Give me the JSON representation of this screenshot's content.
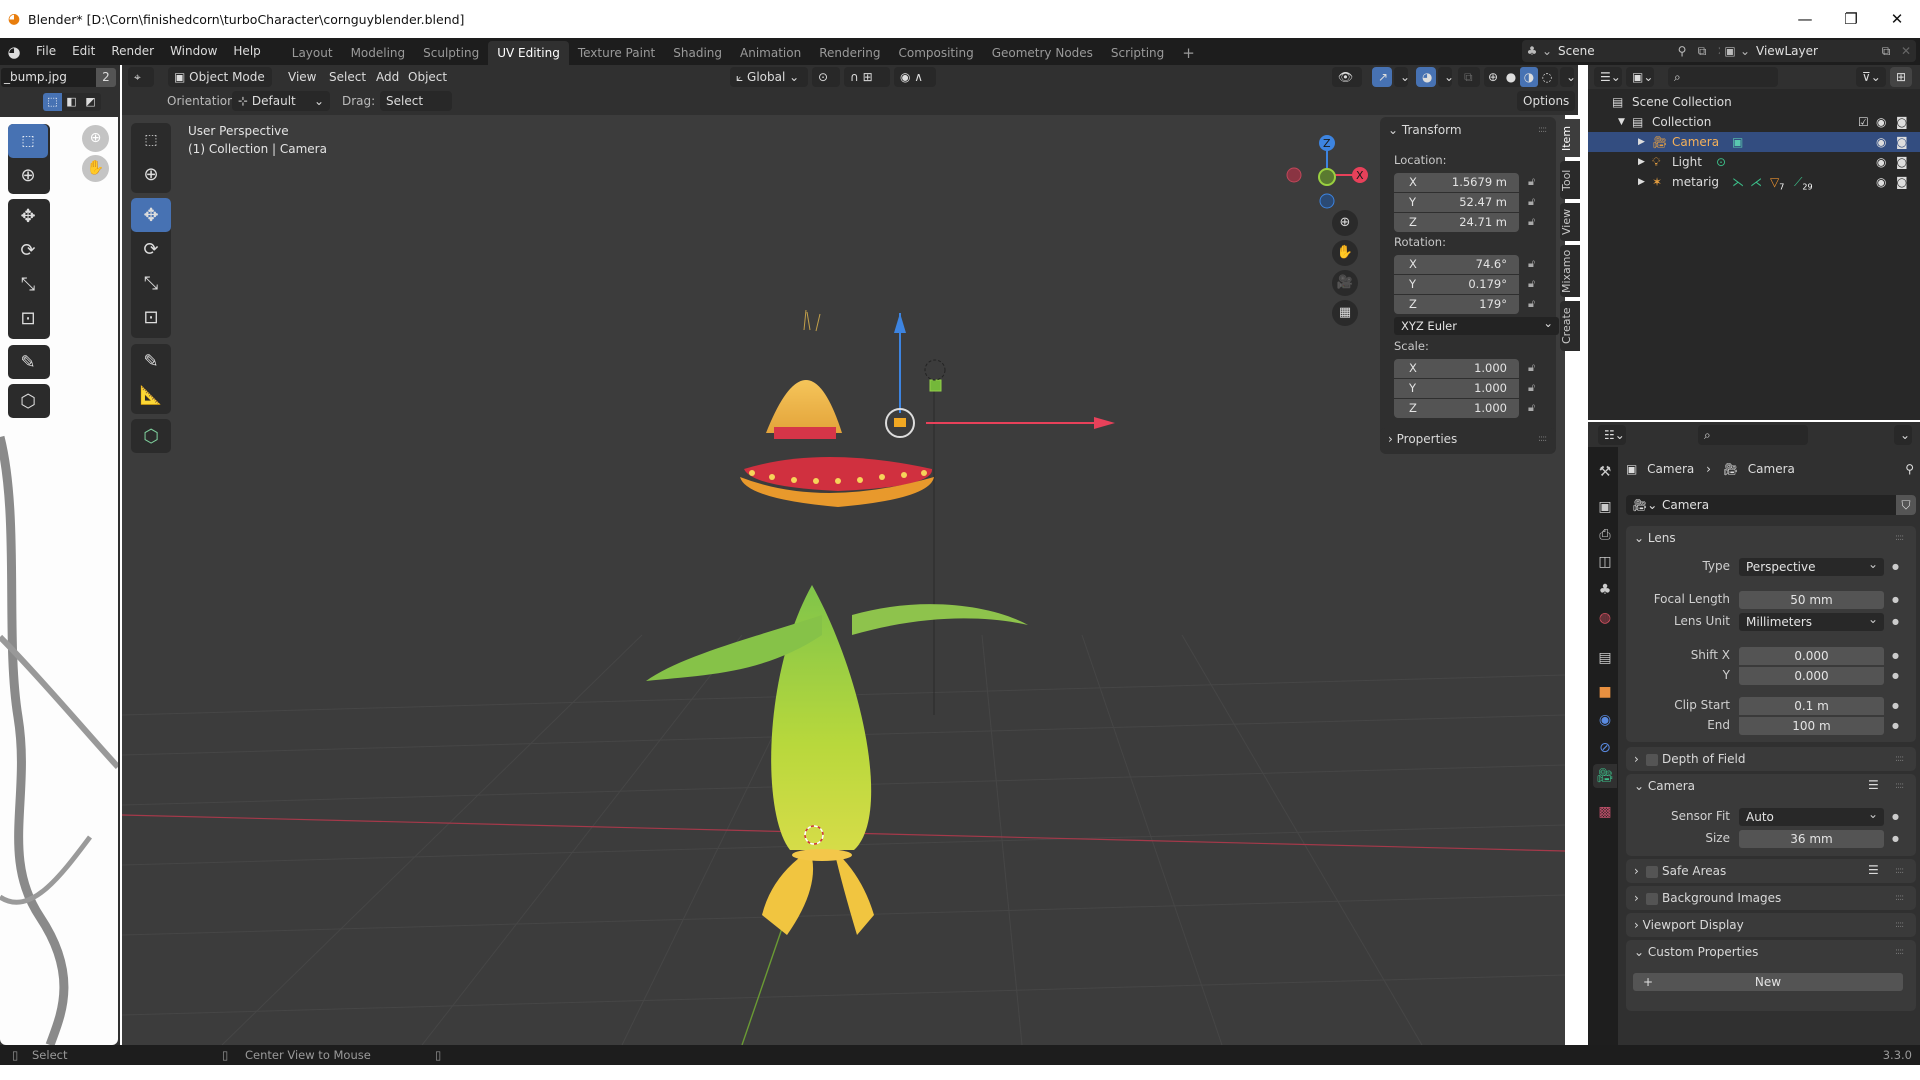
{
  "window": {
    "title": "Blender* [D:\\Corn\\finishedcorn\\turboCharacter\\cornguyblender.blend]",
    "controls": {
      "minimize": "—",
      "maximize": "❐",
      "close": "✕"
    }
  },
  "menu": {
    "items": [
      "File",
      "Edit",
      "Render",
      "Window",
      "Help"
    ]
  },
  "workspaces": {
    "tabs": [
      "Layout",
      "Modeling",
      "Sculpting",
      "UV Editing",
      "Texture Paint",
      "Shading",
      "Animation",
      "Rendering",
      "Compositing",
      "Geometry Nodes",
      "Scripting"
    ],
    "active": "UV Editing",
    "add": "+"
  },
  "scene": {
    "name": "Scene",
    "view_layer": "ViewLayer"
  },
  "uv_editor": {
    "image_name": "_bump.jpg",
    "image_users": "2"
  },
  "viewport": {
    "mode": "Object Mode",
    "menus": [
      "View",
      "Select",
      "Add",
      "Object"
    ],
    "orientation_label": "Orientation:",
    "orientation_value": "Default",
    "drag_label": "Drag:",
    "drag_value": "Select Box",
    "transform_orientation": "Global",
    "options_label": "Options",
    "info_line1": "User Perspective",
    "info_line2": "(1) Collection | Camera",
    "gizmo": {
      "x": "X",
      "y": "Y",
      "z": "Z"
    },
    "colors": {
      "x_axis": "#e8415a",
      "y_axis": "#8cc43f",
      "z_axis": "#3d84e0",
      "accent": "#4772b3"
    }
  },
  "npanel": {
    "section": "Transform",
    "location_label": "Location:",
    "location": [
      {
        "axis": "X",
        "value": "1.5679 m"
      },
      {
        "axis": "Y",
        "value": "52.47 m"
      },
      {
        "axis": "Z",
        "value": "24.71 m"
      }
    ],
    "rotation_label": "Rotation:",
    "rotation": [
      {
        "axis": "X",
        "value": "74.6°"
      },
      {
        "axis": "Y",
        "value": "0.179°"
      },
      {
        "axis": "Z",
        "value": "179°"
      }
    ],
    "rotation_mode": "XYZ Euler",
    "scale_label": "Scale:",
    "scale": [
      {
        "axis": "X",
        "value": "1.000"
      },
      {
        "axis": "Y",
        "value": "1.000"
      },
      {
        "axis": "Z",
        "value": "1.000"
      }
    ],
    "properties_label": "Properties",
    "tabs": [
      "Item",
      "Tool",
      "View",
      "Mixamo",
      "Create"
    ]
  },
  "outliner": {
    "scene_collection": "Scene Collection",
    "collection": "Collection",
    "objects": [
      {
        "name": "Camera",
        "selected": true
      },
      {
        "name": "Light",
        "selected": false
      },
      {
        "name": "metarig",
        "selected": false,
        "badge1": "7",
        "badge2": "29"
      }
    ]
  },
  "properties": {
    "breadcrumb_object": "Camera",
    "breadcrumb_data": "Camera",
    "datablock": "Camera",
    "lens": {
      "title": "Lens",
      "type_label": "Type",
      "type_value": "Perspective",
      "focal_label": "Focal Length",
      "focal_value": "50 mm",
      "unit_label": "Lens Unit",
      "unit_value": "Millimeters",
      "shiftx_label": "Shift X",
      "shiftx_value": "0.000",
      "shifty_label": "Y",
      "shifty_value": "0.000",
      "clipstart_label": "Clip Start",
      "clipstart_value": "0.1 m",
      "clipend_label": "End",
      "clipend_value": "100 m"
    },
    "dof": "Depth of Field",
    "camera": {
      "title": "Camera",
      "fit_label": "Sensor Fit",
      "fit_value": "Auto",
      "size_label": "Size",
      "size_value": "36 mm"
    },
    "safe_areas": "Safe Areas",
    "background_images": "Background Images",
    "viewport_display": "Viewport Display",
    "custom_properties": "Custom Properties",
    "new_button": "New"
  },
  "statusbar": {
    "left_action": "Select",
    "middle_action": "Center View to Mouse",
    "version": "3.3.0"
  }
}
